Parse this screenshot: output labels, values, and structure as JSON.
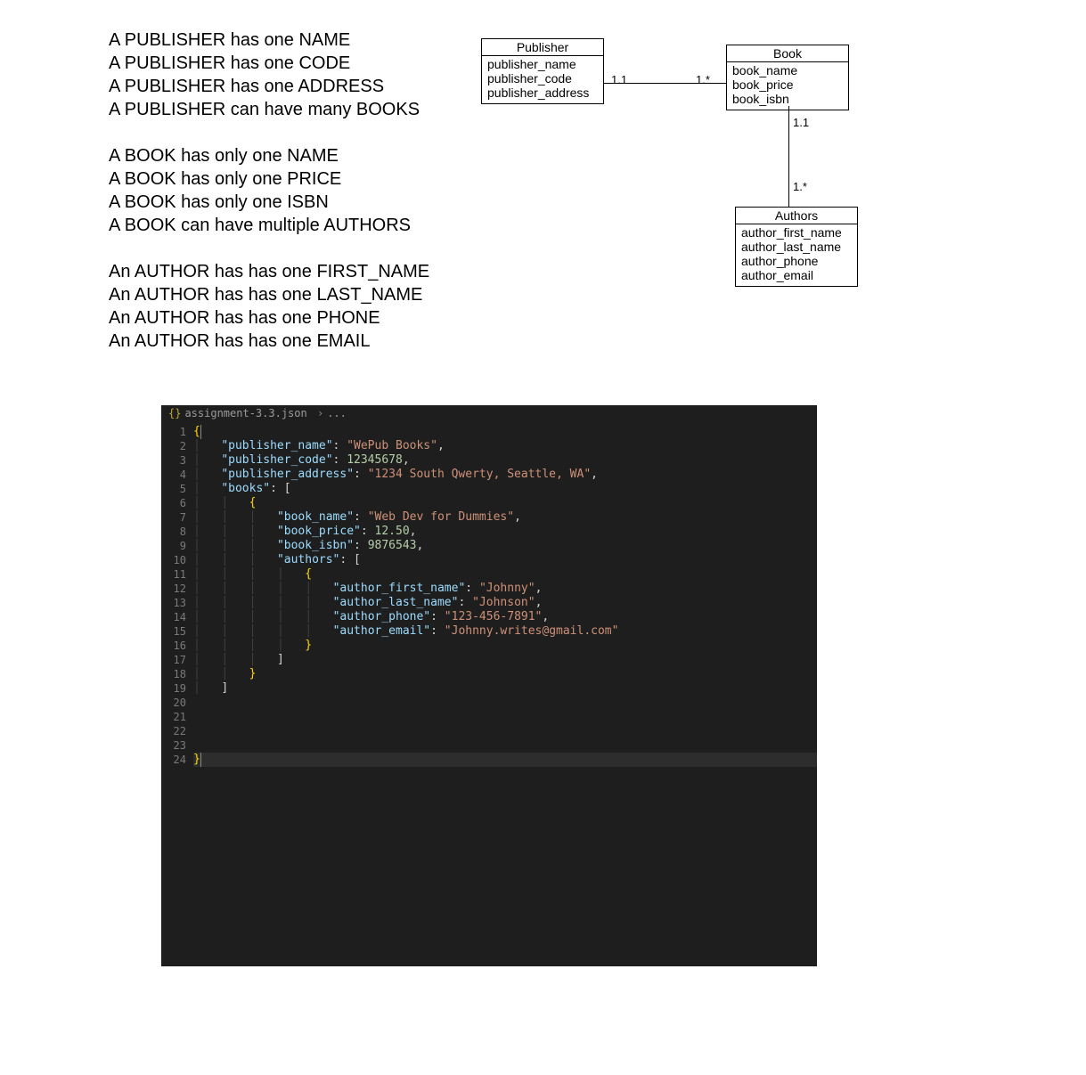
{
  "requirements": {
    "group1": [
      "A PUBLISHER has one NAME",
      "A PUBLISHER has one CODE",
      "A PUBLISHER has one ADDRESS",
      "A PUBLISHER can have many BOOKS"
    ],
    "group2": [
      "A BOOK has only one NAME",
      "A BOOK has only one PRICE",
      "A BOOK has only one ISBN",
      "A BOOK can have multiple AUTHORS"
    ],
    "group3": [
      "An AUTHOR has has one FIRST_NAME",
      "An AUTHOR has has one LAST_NAME",
      "An AUTHOR has has one PHONE",
      "An AUTHOR has has one EMAIL"
    ]
  },
  "diagram": {
    "publisher": {
      "title": "Publisher",
      "fields": [
        "publisher_name",
        "publisher_code",
        "publisher_address"
      ]
    },
    "book": {
      "title": "Book",
      "fields": [
        "book_name",
        "book_price",
        "book_isbn"
      ]
    },
    "authors": {
      "title": "Authors",
      "fields": [
        "author_first_name",
        "author_last_name",
        "author_phone",
        "author_email"
      ]
    },
    "multiplicities": {
      "pub_side": "1.1",
      "book_side": "1.*",
      "book_down": "1.1",
      "author_up": "1.*"
    }
  },
  "editor": {
    "breadcrumb_icon": "{}",
    "breadcrumb_file": "assignment-3.3.json",
    "breadcrumb_sep": "›",
    "breadcrumb_tail": "...",
    "line_count": 24,
    "json": {
      "publisher_name": "WePub Books",
      "publisher_code": 12345678,
      "publisher_address": "1234 South Qwerty, Seattle, WA",
      "books_key": "books",
      "book_name": "Web Dev for Dummies",
      "book_price": "12.50",
      "book_isbn": 9876543,
      "authors_key": "authors",
      "author_first_name": "Johnny",
      "author_last_name": "Johnson",
      "author_phone": "123-456-7891",
      "author_email": "Johnny.writes@gmail.com"
    }
  }
}
